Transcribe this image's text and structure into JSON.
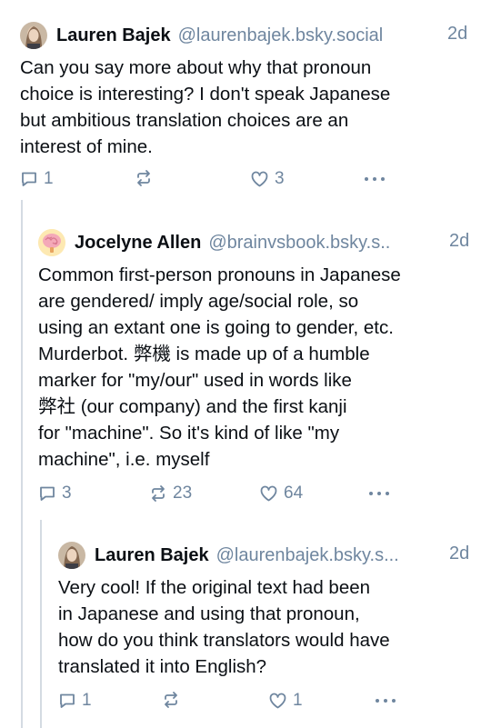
{
  "colors": {
    "text": "#0b0f14",
    "muted": "#6f869f",
    "line": "#d4dbe2"
  },
  "posts": [
    {
      "name": "Lauren Bajek",
      "handle": "@laurenbajek.bsky.social",
      "time": "2d",
      "text": "Can you say more about why that pronoun\nchoice is interesting? I don't speak Japanese\nbut ambitious translation choices are an\ninterest of mine.",
      "replies": "1",
      "reposts": "",
      "likes": "3"
    },
    {
      "name": "Jocelyne Allen",
      "handle": "@brainvsbook.bsky.s..",
      "time": "2d",
      "text": "Common first-person pronouns in Japanese\nare gendered/ imply age/social role, so\nusing an extant one is going to gender, etc.\nMurderbot. 弊機 is made up of a humble\nmarker for \"my/our\" used in words like\n弊社 (our company) and the first kanji\nfor \"machine\". So it's kind of like \"my\nmachine\", i.e. myself",
      "replies": "3",
      "reposts": "23",
      "likes": "64"
    },
    {
      "name": "Lauren Bajek",
      "handle": "@laurenbajek.bsky.s...",
      "time": "2d",
      "text": "Very cool! If the original text had been\nin Japanese and using that pronoun,\nhow do you think translators would have\ntranslated it into English?",
      "replies": "1",
      "reposts": "",
      "likes": "1"
    }
  ]
}
